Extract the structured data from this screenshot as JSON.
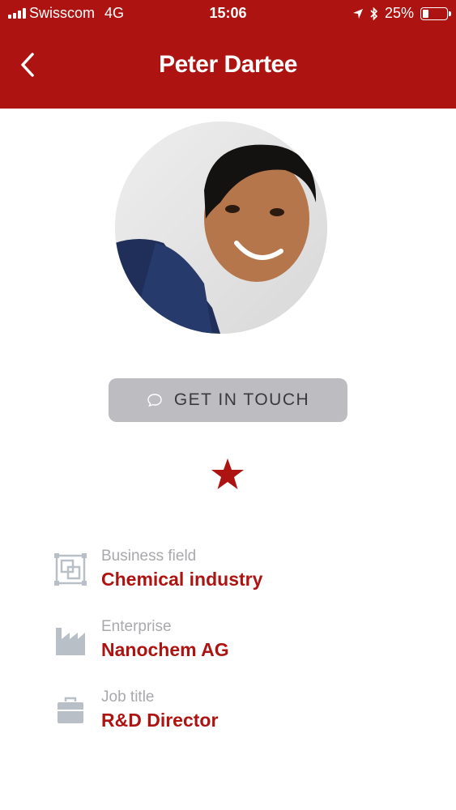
{
  "status_bar": {
    "carrier": "Swisscom",
    "network": "4G",
    "time": "15:06",
    "battery": "25%",
    "battery_level": 0.25
  },
  "nav": {
    "title": "Peter Dartee",
    "back_icon": "chevron-left-icon"
  },
  "profile": {
    "get_in_touch_label": "GET IN TOUCH",
    "get_in_touch_icon": "chat-bubble-icon",
    "favorite_icon": "star-icon",
    "favorited": true
  },
  "details": [
    {
      "label": "Business field",
      "value": "Chemical industry",
      "icon": "business-field-icon"
    },
    {
      "label": "Enterprise",
      "value": "Nanochem AG",
      "icon": "factory-icon"
    },
    {
      "label": "Job title",
      "value": "R&D Director",
      "icon": "briefcase-icon"
    }
  ],
  "colors": {
    "brand_red": "#ad1411",
    "button_gray": "#bdbdc1",
    "label_gray": "#a9a9ad",
    "icon_gray": "#b9bfc6"
  }
}
